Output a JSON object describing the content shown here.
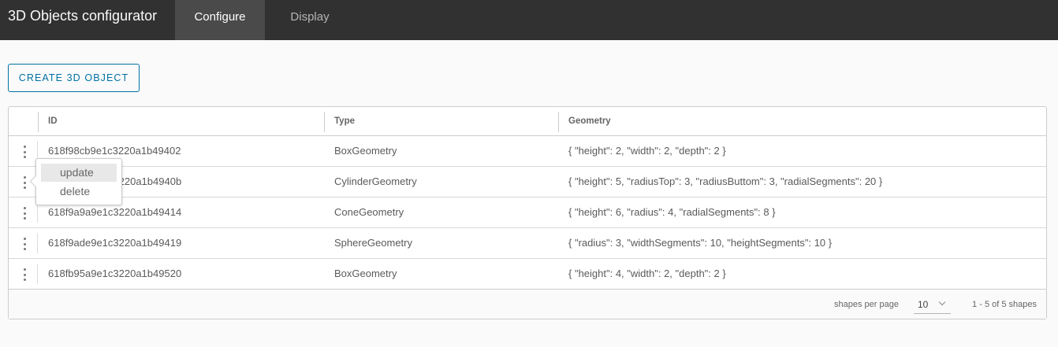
{
  "header": {
    "app_title": "3D Objects configurator",
    "tabs": [
      {
        "label": "Configure",
        "active": true
      },
      {
        "label": "Display",
        "active": false
      }
    ]
  },
  "toolbar": {
    "create_label": "CREATE 3D OBJECT"
  },
  "grid": {
    "columns": [
      "ID",
      "Type",
      "Geometry"
    ],
    "rows": [
      {
        "id": "618f98cb9e1c3220a1b49402",
        "type": "BoxGeometry",
        "geometry": "{ \"height\": 2, \"width\": 2, \"depth\": 2 }"
      },
      {
        "id": "618f992b9e1c3220a1b4940b",
        "id_visible": "220a1b4940b",
        "type": "CylinderGeometry",
        "geometry": "{ \"height\": 5, \"radiusTop\": 3, \"radiusButtom\": 3, \"radialSegments\": 20 }"
      },
      {
        "id": "618f9a9a9e1c3220a1b49414",
        "type": "ConeGeometry",
        "geometry": "{ \"height\": 6, \"radius\": 4, \"radialSegments\": 8 }"
      },
      {
        "id": "618f9ade9e1c3220a1b49419",
        "type": "SphereGeometry",
        "geometry": "{ \"radius\": 3, \"widthSegments\": 10, \"heightSegments\": 10 }"
      },
      {
        "id": "618fb95a9e1c3220a1b49520",
        "type": "BoxGeometry",
        "geometry": "{ \"height\": 4, \"width\": 2, \"depth\": 2 }"
      }
    ],
    "footer": {
      "per_page_label": "shapes per page",
      "per_page_value": "10",
      "range_text": "1 - 5 of 5 shapes"
    }
  },
  "action_menu": {
    "items": [
      {
        "label": "update",
        "hovered": true
      },
      {
        "label": "delete",
        "hovered": false
      }
    ]
  },
  "colors": {
    "header_bg": "#313131",
    "active_tab_bg": "#4a4a4a",
    "accent": "#0072a3"
  },
  "icons": {
    "row_actions": "kebab-vertical-icon",
    "dropdown": "chevron-down-icon"
  }
}
